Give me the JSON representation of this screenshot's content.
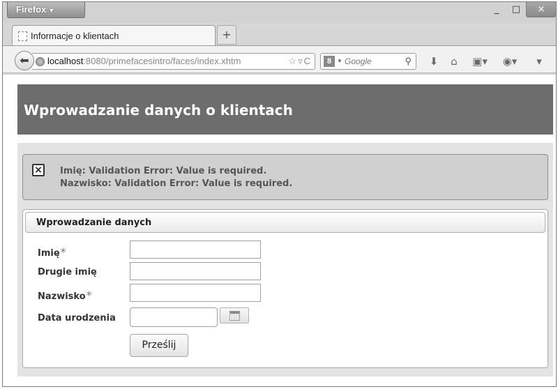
{
  "browser": {
    "app_button": "Firefox",
    "tab_title": "Informacje o klientach",
    "new_tab_symbol": "+",
    "url_host": "localhost",
    "url_rest": ":8080/primefacesintro/faces/index.xhtm",
    "search_placeholder": "Google",
    "window_controls": {
      "minimize": "_",
      "maximize": "□",
      "close": "×"
    }
  },
  "page": {
    "header_title": "Wprowadzanie danych o klientach",
    "messages": [
      "Imię: Validation Error: Value is required.",
      "Nazwisko: Validation Error: Value is required."
    ],
    "panel_title": "Wprowadzanie danych",
    "fields": {
      "first_name": {
        "label": "Imię",
        "required_mark": "*",
        "value": ""
      },
      "middle_name": {
        "label": "Drugie imię",
        "value": ""
      },
      "last_name": {
        "label": "Nazwisko",
        "required_mark": "*",
        "value": ""
      },
      "birth_date": {
        "label": "Data urodzenia",
        "value": ""
      }
    },
    "submit_label": "Prześlij"
  },
  "icons": {
    "back": "back-arrow-icon",
    "error": "error-close-icon",
    "calendar": "calendar-icon"
  },
  "colors": {
    "header_bg": "#6d6d6d",
    "content_bg": "#e3e3e3",
    "message_bg": "#d0d0d0"
  }
}
